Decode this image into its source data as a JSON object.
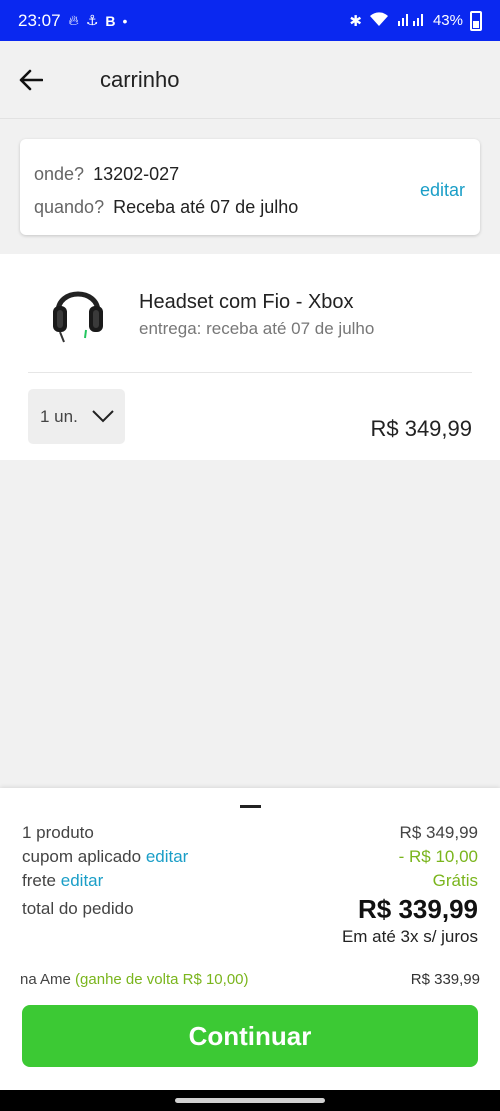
{
  "status_bar": {
    "time": "23:07",
    "battery": "43%"
  },
  "header": {
    "title": "carrinho"
  },
  "delivery_info": {
    "where_label": "onde?",
    "where_value": "13202-027",
    "when_label": "quando?",
    "when_value": "Receba até 07 de julho",
    "edit_label": "editar"
  },
  "product": {
    "name": "Headset com Fio - Xbox",
    "delivery": "entrega: receba até 07 de julho",
    "quantity": "1 un.",
    "price": "R$ 349,99"
  },
  "summary": {
    "items_label": "1 produto",
    "items_value": "R$ 349,99",
    "coupon_label": "cupom aplicado",
    "coupon_edit": "editar",
    "coupon_value": "- R$ 10,00",
    "shipping_label": "frete",
    "shipping_edit": "editar",
    "shipping_value": "Grátis",
    "total_label": "total do pedido",
    "total_value": "R$ 339,99",
    "installments": "Em até 3x s/ juros",
    "ame_label": "na Ame",
    "ame_cashback": "(ganhe de volta R$ 10,00)",
    "ame_value": "R$ 339,99",
    "continue_label": "Continuar"
  },
  "colors": {
    "status_bar": "#0a28f0",
    "link": "#1a9ec7",
    "green": "#7ab51d",
    "button": "#3cc934"
  }
}
